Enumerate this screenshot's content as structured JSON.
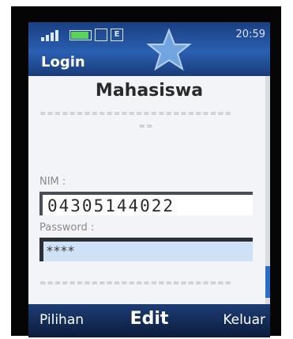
{
  "status_bar": {
    "time": "20:59",
    "network_type": "E",
    "battery_level": 0.9
  },
  "screen_title": "Login",
  "form": {
    "heading": "Mahasiswa",
    "divider": "==========================",
    "divider_tail": "==",
    "nim_label": "NIM :",
    "nim_value": "04305144022",
    "password_label": "Password :",
    "password_value": "****"
  },
  "softkeys": {
    "left": "Pilihan",
    "center": "Edit",
    "right": "Keluar"
  },
  "icons": {
    "signal": "signal-icon",
    "battery": "battery-icon",
    "network": "network-icon",
    "star": "star-icon"
  },
  "colors": {
    "bar_blue": "#2a5fb2",
    "selection_blue": "#cfe1f5",
    "scroll_thumb": "#2b6cc4"
  }
}
